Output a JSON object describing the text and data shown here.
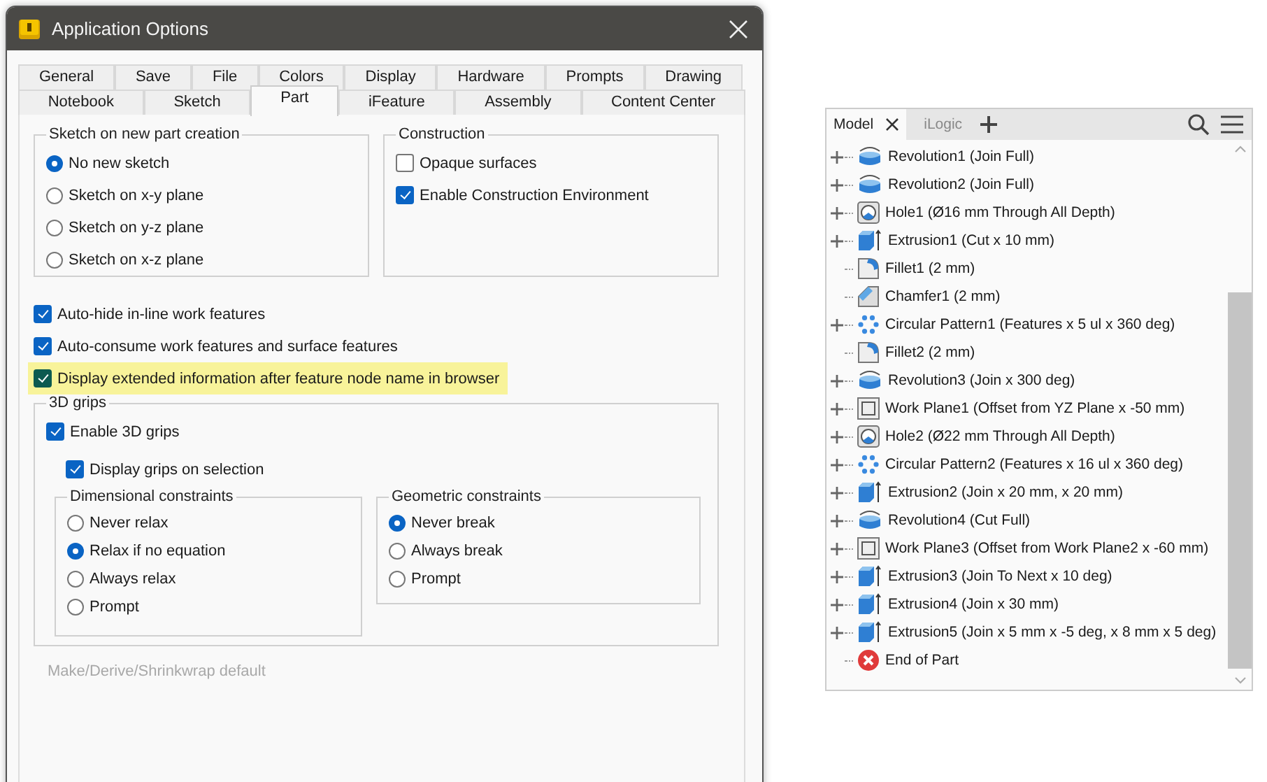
{
  "dialog": {
    "title": "Application Options",
    "tab_rows": [
      [
        {
          "label": "General",
          "selected": false
        },
        {
          "label": "Save",
          "selected": false
        },
        {
          "label": "File",
          "selected": false
        },
        {
          "label": "Colors",
          "selected": false
        },
        {
          "label": "Display",
          "selected": false
        },
        {
          "label": "Hardware",
          "selected": false
        },
        {
          "label": "Prompts",
          "selected": false
        },
        {
          "label": "Drawing",
          "selected": false
        }
      ],
      [
        {
          "label": "Notebook",
          "selected": false
        },
        {
          "label": "Sketch",
          "selected": false
        },
        {
          "label": "Part",
          "selected": true
        },
        {
          "label": "iFeature",
          "selected": false
        },
        {
          "label": "Assembly",
          "selected": false
        },
        {
          "label": "Content Center",
          "selected": false
        }
      ]
    ],
    "sketch_group": {
      "title": "Sketch on new part creation",
      "options": [
        {
          "label": "No new sketch",
          "selected": true
        },
        {
          "label": "Sketch on x-y plane",
          "selected": false
        },
        {
          "label": "Sketch on y-z plane",
          "selected": false
        },
        {
          "label": "Sketch on x-z plane",
          "selected": false
        }
      ]
    },
    "construction_group": {
      "title": "Construction",
      "options": [
        {
          "label": "Opaque surfaces",
          "checked": false
        },
        {
          "label": "Enable Construction Environment",
          "checked": true
        }
      ]
    },
    "options": [
      {
        "label": "Auto-hide in-line work features",
        "checked": true,
        "highlighted": false
      },
      {
        "label": "Auto-consume work features and surface features",
        "checked": true,
        "highlighted": false
      },
      {
        "label": "Display extended information after feature node name in browser",
        "checked": true,
        "highlighted": true
      }
    ],
    "grips_group": {
      "title": "3D grips",
      "enable": {
        "label": "Enable 3D grips",
        "checked": true
      },
      "display": {
        "label": "Display grips on selection",
        "checked": true
      },
      "dimensional": {
        "title": "Dimensional constraints",
        "options": [
          {
            "label": "Never relax",
            "selected": false
          },
          {
            "label": "Relax if no equation",
            "selected": true
          },
          {
            "label": "Always relax",
            "selected": false
          },
          {
            "label": "Prompt",
            "selected": false
          }
        ]
      },
      "geometric": {
        "title": "Geometric constraints",
        "options": [
          {
            "label": "Never break",
            "selected": true
          },
          {
            "label": "Always break",
            "selected": false
          },
          {
            "label": "Prompt",
            "selected": false
          }
        ]
      }
    },
    "disabled_section": {
      "title": "Make/Derive/Shrinkwrap default",
      "disabled": true
    }
  },
  "browser": {
    "tabs": [
      {
        "label": "Model",
        "selected": true
      },
      {
        "label": "iLogic",
        "selected": false
      }
    ],
    "items": [
      {
        "kind": "revolution",
        "expandable": true,
        "label": "Revolution1 (Join Full)"
      },
      {
        "kind": "revolution",
        "expandable": true,
        "label": "Revolution2 (Join Full)"
      },
      {
        "kind": "hole",
        "expandable": true,
        "label": "Hole1 (Ø16 mm Through All Depth)"
      },
      {
        "kind": "extrusion",
        "expandable": true,
        "label": "Extrusion1 (Cut x 10 mm)"
      },
      {
        "kind": "fillet",
        "expandable": false,
        "label": "Fillet1 (2 mm)"
      },
      {
        "kind": "chamfer",
        "expandable": false,
        "label": "Chamfer1 (2 mm)"
      },
      {
        "kind": "pattern",
        "expandable": true,
        "label": "Circular Pattern1 (Features x 5 ul x 360 deg)"
      },
      {
        "kind": "fillet",
        "expandable": false,
        "label": "Fillet2 (2 mm)"
      },
      {
        "kind": "revolution",
        "expandable": true,
        "label": "Revolution3 (Join x 300 deg)"
      },
      {
        "kind": "workplane",
        "expandable": true,
        "label": "Work Plane1 (Offset from YZ Plane x -50 mm)"
      },
      {
        "kind": "hole",
        "expandable": true,
        "label": "Hole2 (Ø22 mm Through All Depth)"
      },
      {
        "kind": "pattern",
        "expandable": true,
        "label": "Circular Pattern2 (Features x 16 ul x 360 deg)"
      },
      {
        "kind": "extrusion",
        "expandable": true,
        "label": "Extrusion2 (Join x 20 mm, x 20 mm)"
      },
      {
        "kind": "revolution",
        "expandable": true,
        "label": "Revolution4 (Cut Full)"
      },
      {
        "kind": "workplane",
        "expandable": true,
        "label": "Work Plane3 (Offset from Work Plane2 x -60 mm)"
      },
      {
        "kind": "extrusion",
        "expandable": true,
        "label": "Extrusion3 (Join To Next x 10 deg)"
      },
      {
        "kind": "extrusion",
        "expandable": true,
        "label": "Extrusion4 (Join x 30 mm)"
      },
      {
        "kind": "extrusion",
        "expandable": true,
        "label": "Extrusion5 (Join x 5 mm x -5 deg, x 8 mm x 5 deg)"
      },
      {
        "kind": "end",
        "expandable": false,
        "label": "End of Part"
      }
    ]
  }
}
